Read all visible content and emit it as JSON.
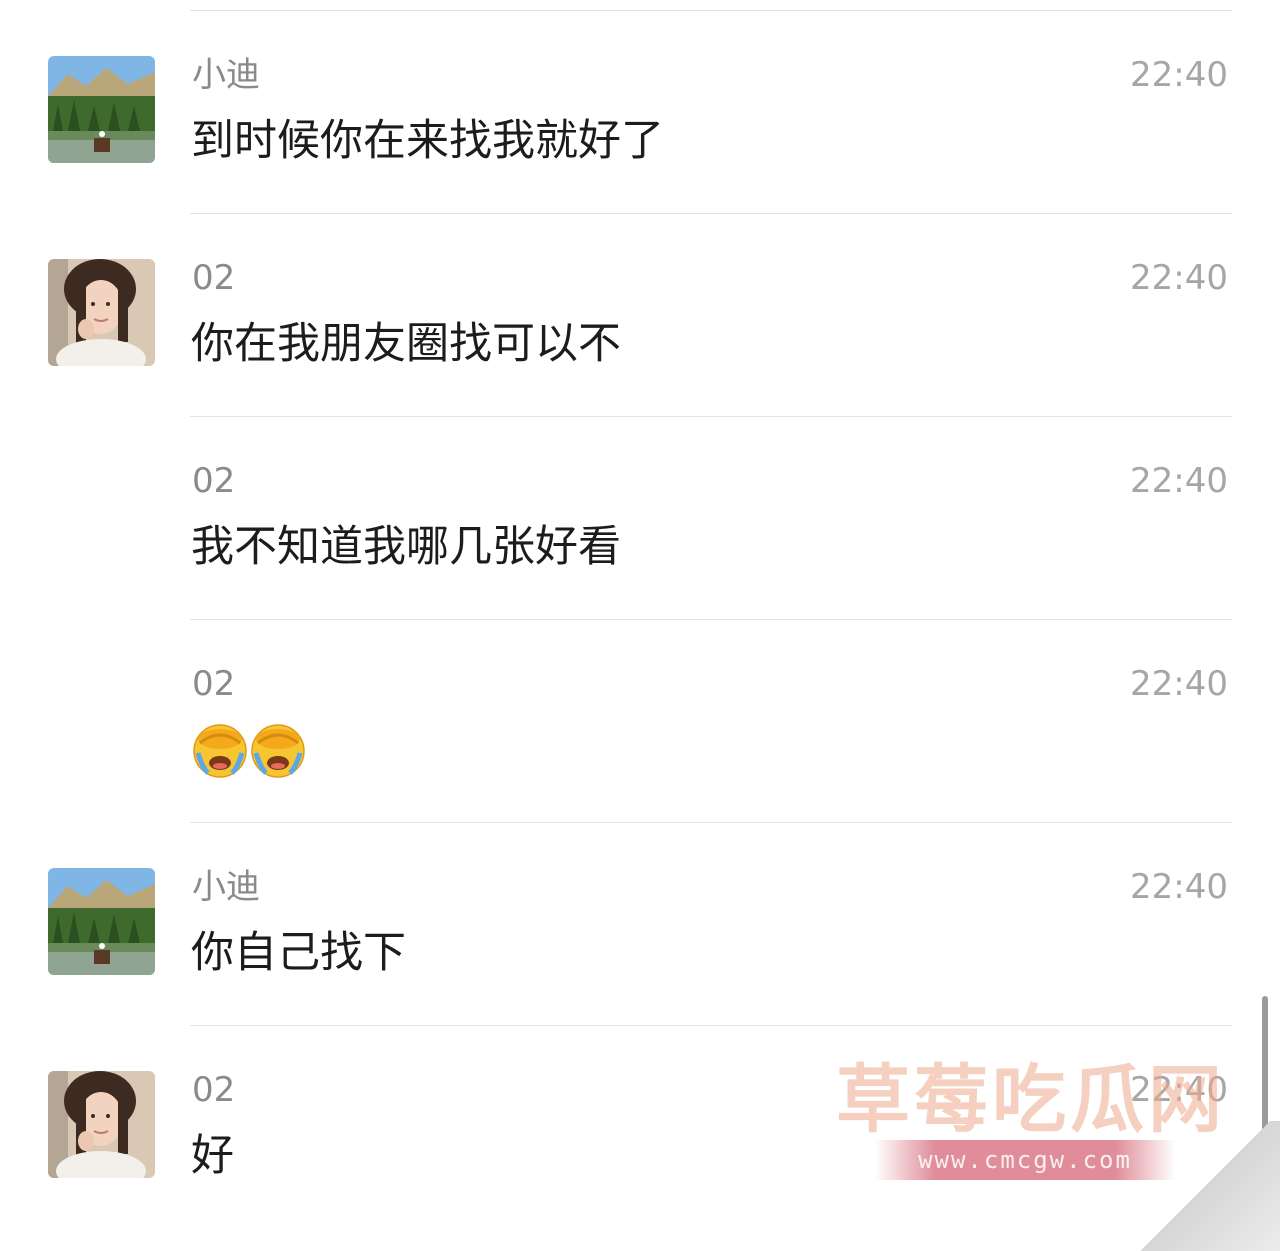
{
  "colors": {
    "divider": "#e2e2e2",
    "sender_text": "#8a8a8a",
    "time_text": "#a6a6a6",
    "message_text": "#1c1c1c"
  },
  "messages": [
    {
      "sender": "小迪",
      "time": "22:40",
      "text": "到时候你在来找我就好了",
      "avatar": "landscape-avatar-icon",
      "show_avatar": true
    },
    {
      "sender": "02",
      "time": "22:40",
      "text": "你在我朋友圈找可以不",
      "avatar": "woman-avatar-icon",
      "show_avatar": true
    },
    {
      "sender": "02",
      "time": "22:40",
      "text": "我不知道我哪几张好看",
      "avatar": "woman-avatar-icon",
      "show_avatar": false
    },
    {
      "sender": "02",
      "time": "22:40",
      "text": "",
      "emojis": [
        "facepalm-crying-emoji",
        "facepalm-crying-emoji"
      ],
      "avatar": "woman-avatar-icon",
      "show_avatar": false
    },
    {
      "sender": "小迪",
      "time": "22:40",
      "text": "你自己找下",
      "avatar": "landscape-avatar-icon",
      "show_avatar": true
    },
    {
      "sender": "02",
      "time": "22:40",
      "text": "好",
      "avatar": "woman-avatar-icon",
      "show_avatar": true
    }
  ],
  "watermark": {
    "title": "草莓吃瓜网",
    "url": "www.cmcgw.com"
  }
}
